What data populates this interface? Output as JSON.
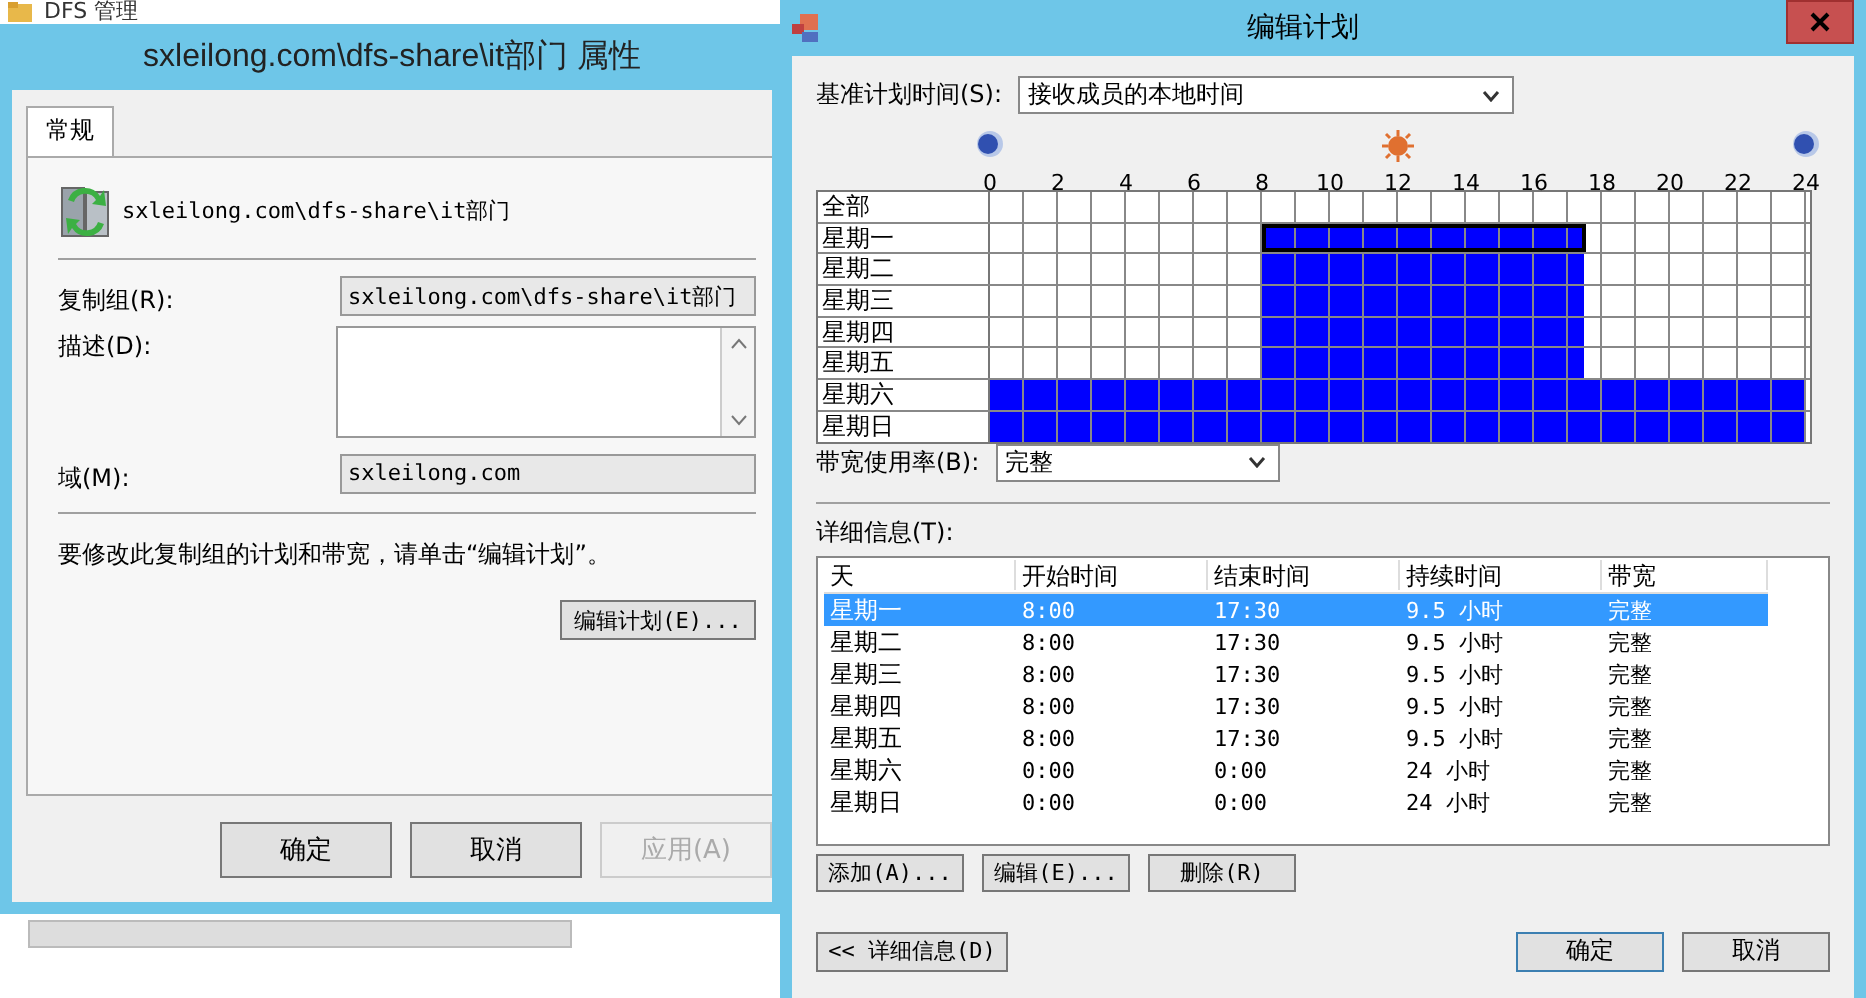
{
  "background_window": {
    "title": "DFS 管理"
  },
  "properties_dialog": {
    "title": "sxleilong.com\\dfs-share\\it部门 属性",
    "tabs": [
      {
        "label": "常规",
        "selected": true
      }
    ],
    "object_name": "sxleilong.com\\dfs-share\\it部门",
    "fields": [
      {
        "kind": "text",
        "label": "复制组(R):",
        "value": "sxleilong.com\\dfs-share\\it部门"
      },
      {
        "kind": "memo",
        "label": "描述(D):"
      },
      {
        "kind": "text",
        "label": "域(M):",
        "value": "sxleilong.com"
      }
    ],
    "note": "要修改此复制组的计划和带宽，请单击“编辑计划”。",
    "edit_button": "编辑计划(E)...",
    "buttons": [
      {
        "label": "确定",
        "disabled": false
      },
      {
        "label": "取消",
        "disabled": false
      },
      {
        "label": "应用(A)",
        "disabled": true
      }
    ]
  },
  "schedule_dialog": {
    "title": "编辑计划",
    "base_time": {
      "label": "基准计划时间(S):",
      "value": "接收成员的本地时间"
    },
    "hour_labels": [
      "0",
      "2",
      "4",
      "6",
      "8",
      "10",
      "12",
      "14",
      "16",
      "18",
      "20",
      "22",
      "24"
    ],
    "grid_rows": [
      {
        "label": "全部",
        "selected": false,
        "slots": [
          false,
          false,
          false,
          false,
          false,
          false,
          false,
          false,
          false,
          false,
          false,
          false,
          false,
          false,
          false,
          false,
          false,
          false,
          false,
          false,
          false,
          false,
          false,
          false,
          false,
          false,
          false,
          false,
          false,
          false,
          false,
          false,
          false,
          false,
          false,
          false,
          false,
          false,
          false,
          false,
          false,
          false,
          false,
          false,
          false,
          false,
          false,
          false
        ]
      },
      {
        "label": "星期一",
        "selected": true,
        "slots": [
          false,
          false,
          false,
          false,
          false,
          false,
          false,
          false,
          false,
          false,
          false,
          false,
          false,
          false,
          false,
          false,
          true,
          true,
          true,
          true,
          true,
          true,
          true,
          true,
          true,
          true,
          true,
          true,
          true,
          true,
          true,
          true,
          true,
          true,
          true,
          false,
          false,
          false,
          false,
          false,
          false,
          false,
          false,
          false,
          false,
          false,
          false,
          false
        ]
      },
      {
        "label": "星期二",
        "selected": false,
        "slots": [
          false,
          false,
          false,
          false,
          false,
          false,
          false,
          false,
          false,
          false,
          false,
          false,
          false,
          false,
          false,
          false,
          true,
          true,
          true,
          true,
          true,
          true,
          true,
          true,
          true,
          true,
          true,
          true,
          true,
          true,
          true,
          true,
          true,
          true,
          true,
          false,
          false,
          false,
          false,
          false,
          false,
          false,
          false,
          false,
          false,
          false,
          false,
          false
        ]
      },
      {
        "label": "星期三",
        "selected": false,
        "slots": [
          false,
          false,
          false,
          false,
          false,
          false,
          false,
          false,
          false,
          false,
          false,
          false,
          false,
          false,
          false,
          false,
          true,
          true,
          true,
          true,
          true,
          true,
          true,
          true,
          true,
          true,
          true,
          true,
          true,
          true,
          true,
          true,
          true,
          true,
          true,
          false,
          false,
          false,
          false,
          false,
          false,
          false,
          false,
          false,
          false,
          false,
          false,
          false
        ]
      },
      {
        "label": "星期四",
        "selected": false,
        "slots": [
          false,
          false,
          false,
          false,
          false,
          false,
          false,
          false,
          false,
          false,
          false,
          false,
          false,
          false,
          false,
          false,
          true,
          true,
          true,
          true,
          true,
          true,
          true,
          true,
          true,
          true,
          true,
          true,
          true,
          true,
          true,
          true,
          true,
          true,
          true,
          false,
          false,
          false,
          false,
          false,
          false,
          false,
          false,
          false,
          false,
          false,
          false,
          false
        ]
      },
      {
        "label": "星期五",
        "selected": false,
        "slots": [
          false,
          false,
          false,
          false,
          false,
          false,
          false,
          false,
          false,
          false,
          false,
          false,
          false,
          false,
          false,
          false,
          true,
          true,
          true,
          true,
          true,
          true,
          true,
          true,
          true,
          true,
          true,
          true,
          true,
          true,
          true,
          true,
          true,
          true,
          true,
          false,
          false,
          false,
          false,
          false,
          false,
          false,
          false,
          false,
          false,
          false,
          false,
          false
        ]
      },
      {
        "label": "星期六",
        "selected": false,
        "slots": [
          true,
          true,
          true,
          true,
          true,
          true,
          true,
          true,
          true,
          true,
          true,
          true,
          true,
          true,
          true,
          true,
          true,
          true,
          true,
          true,
          true,
          true,
          true,
          true,
          true,
          true,
          true,
          true,
          true,
          true,
          true,
          true,
          true,
          true,
          true,
          true,
          true,
          true,
          true,
          true,
          true,
          true,
          true,
          true,
          true,
          true,
          true,
          true
        ]
      },
      {
        "label": "星期日",
        "selected": false,
        "slots": [
          true,
          true,
          true,
          true,
          true,
          true,
          true,
          true,
          true,
          true,
          true,
          true,
          true,
          true,
          true,
          true,
          true,
          true,
          true,
          true,
          true,
          true,
          true,
          true,
          true,
          true,
          true,
          true,
          true,
          true,
          true,
          true,
          true,
          true,
          true,
          true,
          true,
          true,
          true,
          true,
          true,
          true,
          true,
          true,
          true,
          true,
          true,
          true
        ]
      }
    ],
    "bandwidth": {
      "label": "带宽使用率(B):",
      "value": "完整"
    },
    "details": {
      "label": "详细信息(T):",
      "columns": [
        "天",
        "开始时间",
        "结束时间",
        "持续时间",
        "带宽"
      ],
      "rows": [
        {
          "selected": true,
          "cells": [
            "星期一",
            "8:00",
            "17:30",
            "9.5 小时",
            "完整"
          ]
        },
        {
          "selected": false,
          "cells": [
            "星期二",
            "8:00",
            "17:30",
            "9.5 小时",
            "完整"
          ]
        },
        {
          "selected": false,
          "cells": [
            "星期三",
            "8:00",
            "17:30",
            "9.5 小时",
            "完整"
          ]
        },
        {
          "selected": false,
          "cells": [
            "星期四",
            "8:00",
            "17:30",
            "9.5 小时",
            "完整"
          ]
        },
        {
          "selected": false,
          "cells": [
            "星期五",
            "8:00",
            "17:30",
            "9.5 小时",
            "完整"
          ]
        },
        {
          "selected": false,
          "cells": [
            "星期六",
            "0:00",
            "0:00",
            "24 小时",
            "完整"
          ]
        },
        {
          "selected": false,
          "cells": [
            "星期日",
            "0:00",
            "0:00",
            "24 小时",
            "完整"
          ]
        }
      ]
    },
    "action_buttons": [
      "添加(A)...",
      "编辑(E)...",
      "删除(R)"
    ],
    "toggle_button": "<< 详细信息(D)",
    "buttons": [
      "确定",
      "取消"
    ]
  }
}
